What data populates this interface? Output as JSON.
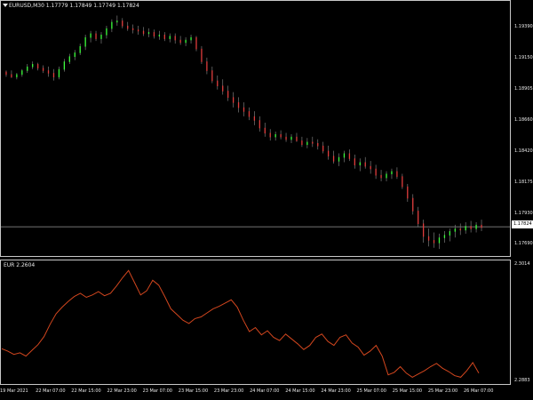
{
  "main_chart": {
    "symbol_info": "EURUSD,M30  1.17779 1.17849 1.17749 1.17824",
    "current_price_label": "1.17824",
    "current_price": 1.17824,
    "price_axis_labels": [
      "1.19390",
      "1.19150",
      "1.18905",
      "1.18660",
      "1.18420",
      "1.18175",
      "1.17930",
      "1.17690"
    ],
    "price_axis_values": [
      1.1939,
      1.1915,
      1.18905,
      1.1866,
      1.1842,
      1.18175,
      1.1793,
      1.1769
    ],
    "y_range": [
      1.1763,
      1.1956
    ],
    "bull_color": "#3cff3c",
    "bear_color": "#e03c3c",
    "wick_color": "#7a7a7a",
    "bars": [
      [
        1.1904,
        1.1905,
        1.19,
        1.1902
      ],
      [
        1.1902,
        1.1905,
        1.1899,
        1.19
      ],
      [
        1.19,
        1.1903,
        1.1898,
        1.1902
      ],
      [
        1.1902,
        1.1906,
        1.19,
        1.1905
      ],
      [
        1.1905,
        1.191,
        1.1903,
        1.1908
      ],
      [
        1.1908,
        1.1912,
        1.1906,
        1.191
      ],
      [
        1.191,
        1.1911,
        1.1905,
        1.1907
      ],
      [
        1.1907,
        1.1909,
        1.1903,
        1.1905
      ],
      [
        1.1905,
        1.1908,
        1.19,
        1.1903
      ],
      [
        1.1903,
        1.1906,
        1.1897,
        1.19
      ],
      [
        1.19,
        1.1908,
        1.1898,
        1.1906
      ],
      [
        1.1906,
        1.1914,
        1.1904,
        1.1912
      ],
      [
        1.1912,
        1.1918,
        1.191,
        1.1916
      ],
      [
        1.1916,
        1.1921,
        1.1913,
        1.1919
      ],
      [
        1.1919,
        1.1926,
        1.1917,
        1.1924
      ],
      [
        1.1924,
        1.1933,
        1.1921,
        1.1931
      ],
      [
        1.1931,
        1.1936,
        1.1927,
        1.1934
      ],
      [
        1.1934,
        1.1936,
        1.1928,
        1.193
      ],
      [
        1.193,
        1.1935,
        1.1926,
        1.1933
      ],
      [
        1.1933,
        1.194,
        1.193,
        1.1938
      ],
      [
        1.1938,
        1.1945,
        1.1935,
        1.1943
      ],
      [
        1.1943,
        1.1948,
        1.194,
        1.1944
      ],
      [
        1.1944,
        1.1946,
        1.1938,
        1.194
      ],
      [
        1.194,
        1.1943,
        1.1936,
        1.1938
      ],
      [
        1.1938,
        1.1941,
        1.1934,
        1.1937
      ],
      [
        1.1937,
        1.194,
        1.1933,
        1.1936
      ],
      [
        1.1936,
        1.1939,
        1.1932,
        1.1934
      ],
      [
        1.1934,
        1.1938,
        1.1931,
        1.1935
      ],
      [
        1.1935,
        1.1937,
        1.193,
        1.1932
      ],
      [
        1.1932,
        1.1936,
        1.1929,
        1.1933
      ],
      [
        1.1933,
        1.1935,
        1.1928,
        1.193
      ],
      [
        1.193,
        1.1934,
        1.1927,
        1.1932
      ],
      [
        1.1932,
        1.1934,
        1.1926,
        1.1929
      ],
      [
        1.1929,
        1.1932,
        1.1925,
        1.1927
      ],
      [
        1.1927,
        1.1931,
        1.1924,
        1.1929
      ],
      [
        1.1929,
        1.1933,
        1.1926,
        1.1931
      ],
      [
        1.1931,
        1.1932,
        1.192,
        1.1922
      ],
      [
        1.1922,
        1.1924,
        1.191,
        1.1912
      ],
      [
        1.1912,
        1.1915,
        1.1902,
        1.1905
      ],
      [
        1.1905,
        1.1908,
        1.1895,
        1.1897
      ],
      [
        1.1897,
        1.1901,
        1.189,
        1.1893
      ],
      [
        1.1893,
        1.1898,
        1.1886,
        1.1889
      ],
      [
        1.1889,
        1.1893,
        1.1881,
        1.1884
      ],
      [
        1.1884,
        1.1888,
        1.1876,
        1.188
      ],
      [
        1.188,
        1.1884,
        1.1872,
        1.1876
      ],
      [
        1.1876,
        1.188,
        1.1869,
        1.1873
      ],
      [
        1.1873,
        1.1876,
        1.1866,
        1.1869
      ],
      [
        1.1869,
        1.1873,
        1.1862,
        1.1866
      ],
      [
        1.1866,
        1.1869,
        1.1857,
        1.186
      ],
      [
        1.186,
        1.1864,
        1.1853,
        1.1856
      ],
      [
        1.1856,
        1.1859,
        1.185,
        1.1853
      ],
      [
        1.1853,
        1.1857,
        1.185,
        1.1855
      ],
      [
        1.1855,
        1.1858,
        1.1851,
        1.1853
      ],
      [
        1.1853,
        1.1856,
        1.1849,
        1.1851
      ],
      [
        1.1851,
        1.1855,
        1.1848,
        1.1853
      ],
      [
        1.1853,
        1.1856,
        1.1849,
        1.185
      ],
      [
        1.185,
        1.1853,
        1.1845,
        1.1847
      ],
      [
        1.1847,
        1.1852,
        1.1844,
        1.1849
      ],
      [
        1.1849,
        1.1853,
        1.1845,
        1.1848
      ],
      [
        1.1848,
        1.1851,
        1.1843,
        1.1846
      ],
      [
        1.1846,
        1.1849,
        1.184,
        1.1842
      ],
      [
        1.1842,
        1.1846,
        1.1835,
        1.1838
      ],
      [
        1.1838,
        1.1842,
        1.1832,
        1.1834
      ],
      [
        1.1834,
        1.184,
        1.183,
        1.1837
      ],
      [
        1.1837,
        1.1842,
        1.1833,
        1.184
      ],
      [
        1.184,
        1.1843,
        1.1834,
        1.1836
      ],
      [
        1.1836,
        1.1839,
        1.1828,
        1.1831
      ],
      [
        1.1831,
        1.1836,
        1.1826,
        1.1833
      ],
      [
        1.1833,
        1.1837,
        1.1828,
        1.183
      ],
      [
        1.183,
        1.1834,
        1.1824,
        1.1828
      ],
      [
        1.1828,
        1.1831,
        1.182,
        1.1823
      ],
      [
        1.1823,
        1.1827,
        1.1818,
        1.1821
      ],
      [
        1.1821,
        1.1826,
        1.1818,
        1.1824
      ],
      [
        1.1824,
        1.1828,
        1.182,
        1.1826
      ],
      [
        1.1826,
        1.1829,
        1.182,
        1.1822
      ],
      [
        1.1822,
        1.1824,
        1.1812,
        1.1814
      ],
      [
        1.1814,
        1.1816,
        1.1802,
        1.1805
      ],
      [
        1.1805,
        1.1808,
        1.1792,
        1.1795
      ],
      [
        1.1795,
        1.1798,
        1.1782,
        1.1785
      ],
      [
        1.1785,
        1.1788,
        1.177,
        1.1775
      ],
      [
        1.1775,
        1.1781,
        1.1767,
        1.1772
      ],
      [
        1.1772,
        1.1778,
        1.1766,
        1.177
      ],
      [
        1.177,
        1.1777,
        1.1765,
        1.1774
      ],
      [
        1.1774,
        1.1779,
        1.177,
        1.1776
      ],
      [
        1.1776,
        1.1781,
        1.1771,
        1.1779
      ],
      [
        1.1779,
        1.1784,
        1.1774,
        1.1781
      ],
      [
        1.1781,
        1.1785,
        1.1776,
        1.178
      ],
      [
        1.178,
        1.1786,
        1.1777,
        1.1783
      ],
      [
        1.1783,
        1.1787,
        1.1778,
        1.1781
      ],
      [
        1.1781,
        1.1786,
        1.1778,
        1.1784
      ],
      [
        1.1784,
        1.1788,
        1.1779,
        1.1782
      ]
    ]
  },
  "indicator": {
    "label": "EUR 2.2604",
    "axis_top_label": "2.3014",
    "axis_bottom_label": "2.2883",
    "y_range": [
      2.2875,
      2.302
    ],
    "line_color": "#d2461e",
    "values": [
      2.2915,
      2.2912,
      2.2908,
      2.291,
      2.2906,
      2.2913,
      2.292,
      2.293,
      2.2945,
      2.2958,
      2.2966,
      2.2973,
      2.2979,
      2.2983,
      2.2978,
      2.2981,
      2.2985,
      2.298,
      2.2983,
      2.2992,
      2.3002,
      2.3011,
      2.2996,
      2.2981,
      2.2986,
      2.2999,
      2.2993,
      2.2979,
      2.2964,
      2.2957,
      2.295,
      2.2946,
      2.2952,
      2.2954,
      2.2959,
      2.2964,
      2.2967,
      2.2971,
      2.2975,
      2.2966,
      2.295,
      2.2936,
      2.2941,
      2.2932,
      2.2937,
      2.2929,
      2.2925,
      2.2933,
      2.2927,
      2.2921,
      2.2914,
      2.2919,
      2.2929,
      2.2933,
      2.2924,
      2.2919,
      2.2929,
      2.2932,
      2.2922,
      2.2917,
      2.2907,
      2.2912,
      2.2919,
      2.2906,
      2.2883,
      2.2886,
      2.2893,
      2.2885,
      2.288,
      2.2884,
      2.2888,
      2.2893,
      2.2897,
      2.2891,
      2.2887,
      2.2882,
      2.288,
      2.2888,
      2.2898,
      2.2885
    ]
  },
  "time_axis": {
    "labels": [
      "19 Mar 2021",
      "22 Mar 07:00",
      "22 Mar 15:00",
      "22 Mar 23:00",
      "23 Mar 07:00",
      "23 Mar 15:00",
      "23 Mar 23:00",
      "24 Mar 07:00",
      "24 Mar 15:00",
      "24 Mar 23:00",
      "25 Mar 07:00",
      "25 Mar 15:00",
      "25 Mar 23:00",
      "26 Mar 07:00"
    ]
  }
}
